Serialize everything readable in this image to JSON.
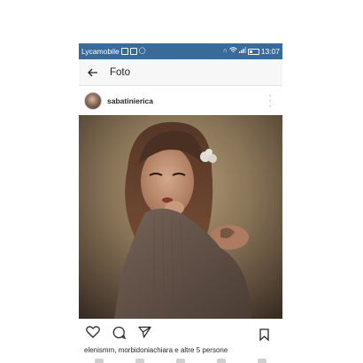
{
  "statusbar": {
    "carrier": "Lycamobile",
    "time": "13:07",
    "left_icons": [
      "sim-icon",
      "image-icon",
      "whatsapp-icon"
    ],
    "right_icons": [
      "headphones-icon",
      "wifi-icon",
      "signal-icon",
      "battery-icon"
    ]
  },
  "appbar": {
    "back_icon": "arrow-left-icon",
    "title": "Foto"
  },
  "post": {
    "username": "sabatinierica",
    "more_icon": "more-vertical-icon",
    "actions": [
      "heart-icon",
      "comment-icon",
      "share-icon",
      "bookmark-icon"
    ],
    "likes_text": "elenismm, morbidoniachiara e altre 5 persone"
  },
  "colors": {
    "statusbar_bg": "#3a6a9a",
    "appbar_bg": "#f7f7f7",
    "text": "#262626"
  }
}
